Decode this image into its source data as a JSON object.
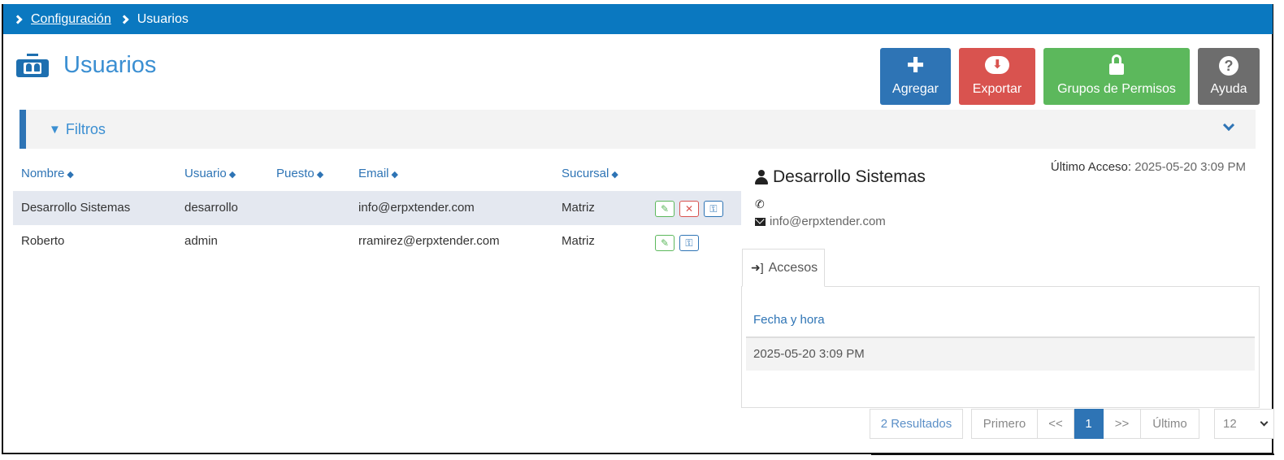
{
  "breadcrumb": {
    "parent": "Configuración",
    "current": "Usuarios"
  },
  "page": {
    "title": "Usuarios"
  },
  "actions": {
    "add": "Agregar",
    "export": "Exportar",
    "permissions": "Grupos de Permisos",
    "help": "Ayuda"
  },
  "filters": {
    "label": "Filtros"
  },
  "table": {
    "columns": [
      "Nombre",
      "Usuario",
      "Puesto",
      "Email",
      "Sucursal"
    ],
    "rows": [
      {
        "nombre": "Desarrollo Sistemas",
        "usuario": "desarrollo",
        "puesto": "",
        "email": "info@erpxtender.com",
        "sucursal": "Matriz",
        "selected": true,
        "can_delete": true
      },
      {
        "nombre": "Roberto",
        "usuario": "admin",
        "puesto": "",
        "email": "rramirez@erpxtender.com",
        "sucursal": "Matriz",
        "selected": false,
        "can_delete": false
      }
    ]
  },
  "detail": {
    "last_access_label": "Último Acceso:",
    "last_access_value": "2025-05-20 3:09 PM",
    "name": "Desarrollo Sistemas",
    "phone": "",
    "email": "info@erpxtender.com",
    "tab_label": "Accesos",
    "accesses": {
      "header": "Fecha y hora",
      "rows": [
        "2025-05-20 3:09 PM"
      ]
    }
  },
  "pagination": {
    "results": "2 Resultados",
    "first": "Primero",
    "prev": "<<",
    "current": "1",
    "next": ">>",
    "last": "Último",
    "page_size": "12"
  },
  "colors": {
    "topbar": "#0a78c0",
    "accent": "#2e74b5",
    "danger": "#d9534f",
    "success": "#5cb85c",
    "muted": "#6d6d6d"
  }
}
